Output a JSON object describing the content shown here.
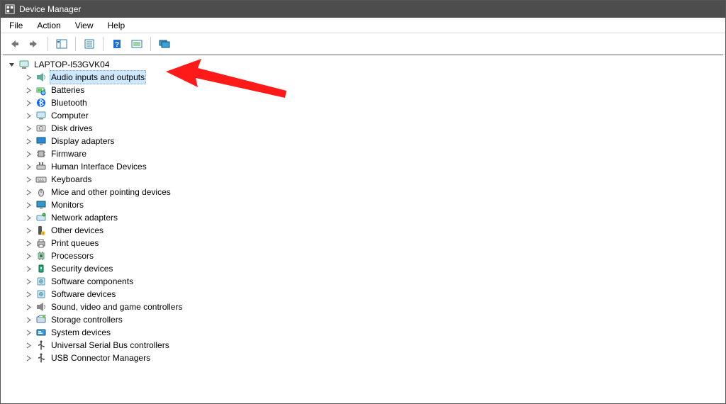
{
  "window": {
    "title": "Device Manager"
  },
  "menu": {
    "items": [
      "File",
      "Action",
      "View",
      "Help"
    ]
  },
  "toolbar": {
    "back": "nav-back",
    "forward": "nav-forward",
    "properties": "properties",
    "help": "help",
    "scan": "scan-hardware",
    "monitors": "monitors"
  },
  "tree": {
    "root": "LAPTOP-I53GVK04",
    "selectedIndex": 0,
    "children": [
      {
        "label": "Audio inputs and outputs",
        "icon": "speaker"
      },
      {
        "label": "Batteries",
        "icon": "battery"
      },
      {
        "label": "Bluetooth",
        "icon": "bluetooth"
      },
      {
        "label": "Computer",
        "icon": "computer"
      },
      {
        "label": "Disk drives",
        "icon": "disk"
      },
      {
        "label": "Display adapters",
        "icon": "display"
      },
      {
        "label": "Firmware",
        "icon": "chip"
      },
      {
        "label": "Human Interface Devices",
        "icon": "hid"
      },
      {
        "label": "Keyboards",
        "icon": "keyboard"
      },
      {
        "label": "Mice and other pointing devices",
        "icon": "mouse"
      },
      {
        "label": "Monitors",
        "icon": "monitor"
      },
      {
        "label": "Network adapters",
        "icon": "network"
      },
      {
        "label": "Other devices",
        "icon": "unknown"
      },
      {
        "label": "Print queues",
        "icon": "printer"
      },
      {
        "label": "Processors",
        "icon": "cpu"
      },
      {
        "label": "Security devices",
        "icon": "security"
      },
      {
        "label": "Software components",
        "icon": "software"
      },
      {
        "label": "Software devices",
        "icon": "software"
      },
      {
        "label": "Sound, video and game controllers",
        "icon": "sound"
      },
      {
        "label": "Storage controllers",
        "icon": "storage"
      },
      {
        "label": "System devices",
        "icon": "system"
      },
      {
        "label": "Universal Serial Bus controllers",
        "icon": "usb"
      },
      {
        "label": "USB Connector Managers",
        "icon": "usb"
      }
    ]
  },
  "annotation": {
    "color": "#ff0000"
  }
}
